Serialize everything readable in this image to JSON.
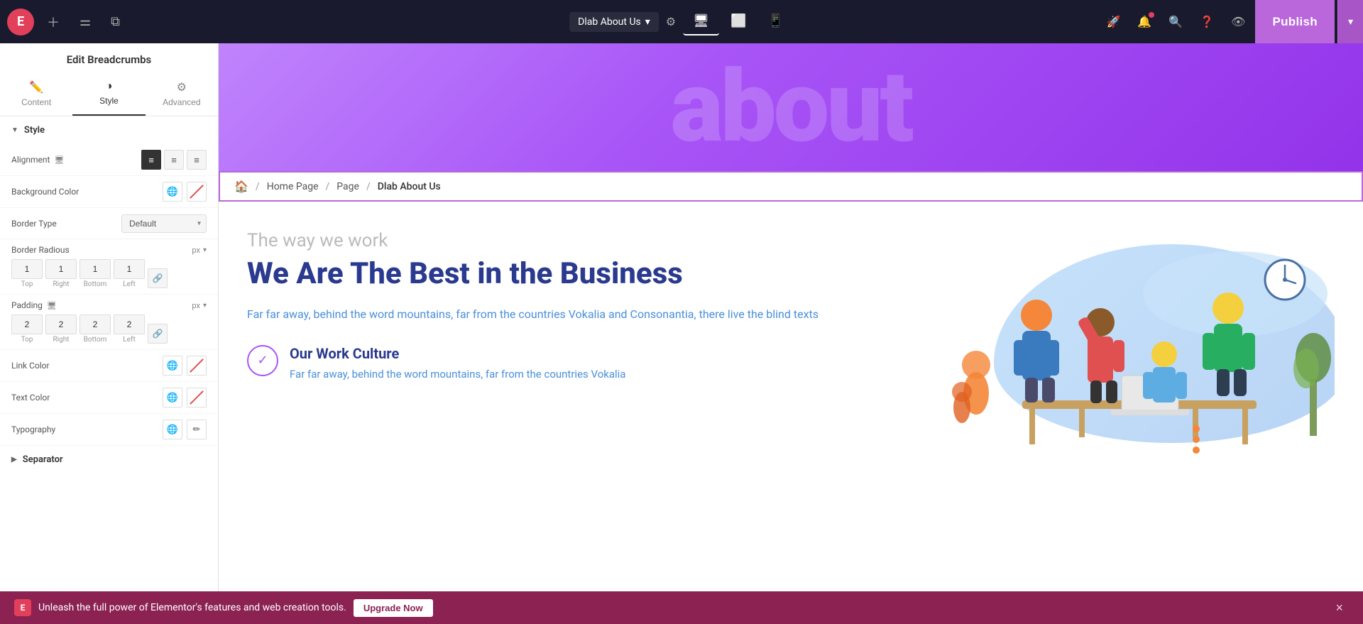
{
  "topbar": {
    "logo_text": "E",
    "site_name": "Dlab About Us",
    "publish_label": "Publish",
    "publish_arrow": "▾"
  },
  "panel": {
    "title": "Edit Breadcrumbs",
    "tabs": [
      {
        "id": "content",
        "label": "Content",
        "icon": "✏️"
      },
      {
        "id": "style",
        "label": "Style",
        "icon": "◑"
      },
      {
        "id": "advanced",
        "label": "Advanced",
        "icon": "⚙"
      }
    ],
    "active_tab": "style",
    "style_section": {
      "section_label": "Style",
      "alignment_label": "Alignment",
      "background_color_label": "Background Color",
      "border_type_label": "Border Type",
      "border_type_value": "Default",
      "border_radius_label": "Border Radious",
      "border_radius_unit": "px",
      "border_radius_values": {
        "top": "1",
        "right": "1",
        "bottom": "1",
        "left": "1"
      },
      "padding_label": "Padding",
      "padding_unit": "px",
      "padding_values": {
        "top": "2",
        "right": "2",
        "bottom": "2",
        "left": "2"
      },
      "link_color_label": "Link Color",
      "text_color_label": "Text Color",
      "typography_label": "Typography"
    },
    "separator_section": {
      "label": "Separator"
    }
  },
  "canvas": {
    "hero_text": "about",
    "breadcrumb": {
      "home_icon": "🏠",
      "items": [
        "Home Page",
        "Page",
        "Dlab About Us"
      ],
      "separators": [
        "/",
        "/"
      ]
    },
    "heading_tagline": "The way we work",
    "heading_main": "We Are The Best in the Business",
    "heading_desc": "Far far away, behind the word mountains, far from the countries Vokalia and Consonantia, there live the blind texts",
    "work_culture_title": "Our Work Culture",
    "work_culture_desc": "Far far away, behind the word mountains, far from the countries Vokalia",
    "work_culture_icon": "✓"
  },
  "banner": {
    "message": "Unleash the full power of Elementor's features and web creation tools.",
    "upgrade_label": "Upgrade Now",
    "close_icon": "×"
  }
}
